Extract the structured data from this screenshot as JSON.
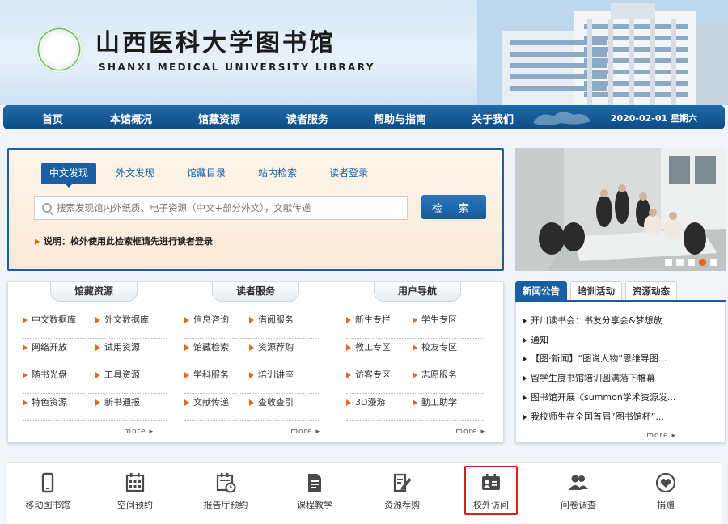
{
  "header": {
    "title_cn": "山西医科大学图书馆",
    "title_en": "SHANXI MEDICAL UNIVERSITY LIBRARY"
  },
  "nav": {
    "items": [
      "首页",
      "本馆概况",
      "馆藏资源",
      "读者服务",
      "帮助与指南",
      "关于我们"
    ],
    "date": "2020-02-01 星期六"
  },
  "search": {
    "tabs": [
      "中文发现",
      "外文发现",
      "馆藏目录",
      "站内检索",
      "读者登录"
    ],
    "active_tab": 0,
    "placeholder": "搜索发现馆内外纸质、电子资源（中文+部分外文），文献传递",
    "button": "检 索",
    "notice": "说明：校外使用此检索框请先进行读者登录"
  },
  "banner": {
    "dot_count": 5,
    "active_dot": 3
  },
  "resources": {
    "columns": [
      {
        "title": "馆藏资源",
        "items": [
          "中文数据库",
          "外文数据库",
          "网络开放",
          "试用资源",
          "随书光盘",
          "工具资源",
          "特色资源",
          "新书通报"
        ],
        "more": "more"
      },
      {
        "title": "读者服务",
        "items": [
          "信息咨询",
          "借阅服务",
          "馆藏检索",
          "资源荐购",
          "学科服务",
          "培训讲座",
          "文献传递",
          "查收查引"
        ],
        "more": "more"
      },
      {
        "title": "用户导航",
        "items": [
          "新生专栏",
          "学生专区",
          "教工专区",
          "校友专区",
          "访客专区",
          "志愿服务",
          "3D漫游",
          "勤工助学"
        ],
        "more": "more"
      }
    ]
  },
  "news": {
    "tabs": [
      "新闻公告",
      "培训活动",
      "资源动态"
    ],
    "active_tab": 0,
    "items": [
      "开川读书会：书友分享会&梦想放",
      "通知",
      "【图·新闻】“图说人物”思维导图...",
      "留学生度书馆培训圆满落下帷幕",
      "图书馆开展《summon学术资源发...",
      "我校师生在全国首届“图书馆杯”..."
    ],
    "more": "more"
  },
  "services": {
    "items": [
      {
        "label": "移动图书馆",
        "icon": "phone-icon"
      },
      {
        "label": "空间预约",
        "icon": "calendar-icon"
      },
      {
        "label": "报告厅预约",
        "icon": "calendar-clock-icon"
      },
      {
        "label": "课程教学",
        "icon": "document-icon"
      },
      {
        "label": "资源荐购",
        "icon": "edit-document-icon"
      },
      {
        "label": "校外访问",
        "icon": "id-card-icon"
      },
      {
        "label": "问卷调查",
        "icon": "users-icon"
      },
      {
        "label": "捐赠",
        "icon": "heart-icon"
      }
    ],
    "highlighted": 5
  },
  "colors": {
    "brand_blue": "#1a5fa3",
    "accent_orange": "#e4671b",
    "highlight_red": "#e01b1b"
  }
}
